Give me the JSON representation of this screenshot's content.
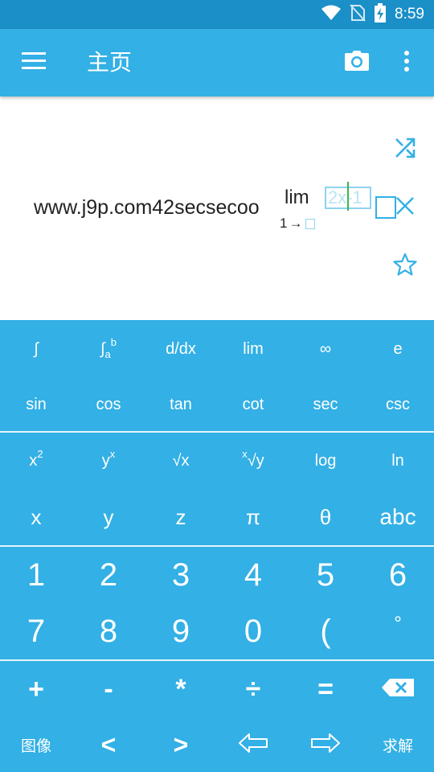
{
  "status_bar": {
    "time": "8:59"
  },
  "app_bar": {
    "title": "主页"
  },
  "editor": {
    "expression_text": "www.j9p.com42secsecoo",
    "lim_word": "lim",
    "lim_from": "1",
    "lim_arrow": "→",
    "lim_body": "2x-1"
  },
  "keypad": {
    "row1": {
      "integral": "∫",
      "definite_integral": "∫",
      "definite_lower": "a",
      "definite_upper": "b",
      "derivative": "d/dx",
      "limit": "lim",
      "infinity": "∞",
      "e": "e"
    },
    "row2": {
      "sin": "sin",
      "cos": "cos",
      "tan": "tan",
      "cot": "cot",
      "sec": "sec",
      "csc": "csc"
    },
    "row3": {
      "square_base": "x",
      "square_exp": "2",
      "power_base": "y",
      "power_exp": "x",
      "sqrt": "√x",
      "nroot_index": "x",
      "nroot_body": "√y",
      "log": "log",
      "ln": "ln"
    },
    "row4": {
      "x": "x",
      "y": "y",
      "z": "z",
      "pi": "π",
      "theta": "θ",
      "abc": "abc"
    },
    "row5": [
      "1",
      "2",
      "3",
      "4",
      "5",
      "6"
    ],
    "row6": [
      "7",
      "8",
      "9",
      "0",
      "(",
      "°"
    ],
    "row7": {
      "plus": "+",
      "minus": "-",
      "times": "*",
      "divide": "÷",
      "equals": "="
    },
    "row8": {
      "image": "图像",
      "less": "<",
      "greater": ">",
      "solve": "求解"
    }
  },
  "colors": {
    "primary": "#33b0e5",
    "status_bar": "#1b8fc7",
    "cursor": "#3bb54a",
    "placeholder": "#8fd3f0"
  },
  "icons": [
    "wifi-icon",
    "no-sim-icon",
    "battery-charging-icon",
    "menu-icon",
    "camera-icon",
    "more-vert-icon",
    "shuffle-icon",
    "close-icon",
    "star-outline-icon",
    "backspace-icon",
    "arrow-left-outline-icon",
    "arrow-right-outline-icon"
  ]
}
